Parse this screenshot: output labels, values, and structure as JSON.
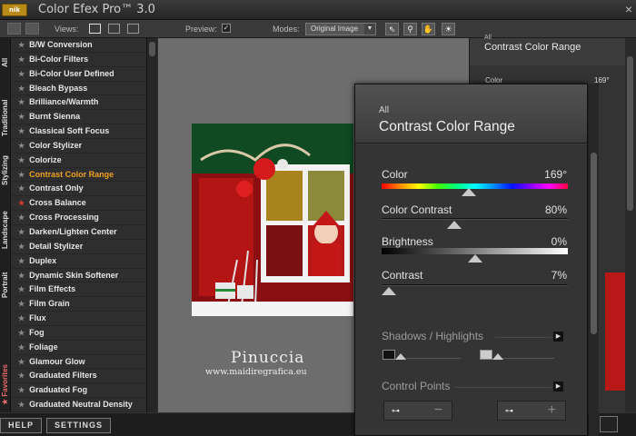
{
  "app": {
    "logo_text": "nik",
    "title": "Color Efex Pro™ 3.0",
    "close_label": "×"
  },
  "toolbar": {
    "views_label": "Views:",
    "preview_label": "Preview:",
    "preview_check": "✓",
    "modes_label": "Modes:",
    "mode_value": "Original Image",
    "mode_arrow": "▼",
    "tools": [
      "⇖",
      "⚲",
      "✋",
      "☀"
    ]
  },
  "categories": [
    {
      "label": "All",
      "fav": false
    },
    {
      "label": "Traditional",
      "fav": false
    },
    {
      "label": "Stylizing",
      "fav": false
    },
    {
      "label": "Landscape",
      "fav": false
    },
    {
      "label": "Portrait",
      "fav": false
    },
    {
      "label": "★ Favorites",
      "fav": true
    }
  ],
  "filters": [
    {
      "label": "B/W Conversion",
      "state": "normal"
    },
    {
      "label": "Bi-Color Filters",
      "state": "normal"
    },
    {
      "label": "Bi-Color User Defined",
      "state": "normal"
    },
    {
      "label": "Bleach Bypass",
      "state": "normal"
    },
    {
      "label": "Brilliance/Warmth",
      "state": "normal"
    },
    {
      "label": "Burnt Sienna",
      "state": "normal"
    },
    {
      "label": "Classical Soft Focus",
      "state": "normal"
    },
    {
      "label": "Color Stylizer",
      "state": "normal"
    },
    {
      "label": "Colorize",
      "state": "normal"
    },
    {
      "label": "Contrast Color Range",
      "state": "active"
    },
    {
      "label": "Contrast Only",
      "state": "normal"
    },
    {
      "label": "Cross Balance",
      "state": "favorite"
    },
    {
      "label": "Cross Processing",
      "state": "normal"
    },
    {
      "label": "Darken/Lighten Center",
      "state": "normal"
    },
    {
      "label": "Detail Stylizer",
      "state": "normal"
    },
    {
      "label": "Duplex",
      "state": "normal"
    },
    {
      "label": "Dynamic Skin Softener",
      "state": "normal"
    },
    {
      "label": "Film Effects",
      "state": "normal"
    },
    {
      "label": "Film Grain",
      "state": "normal"
    },
    {
      "label": "Flux",
      "state": "normal"
    },
    {
      "label": "Fog",
      "state": "normal"
    },
    {
      "label": "Foliage",
      "state": "normal"
    },
    {
      "label": "Glamour Glow",
      "state": "normal"
    },
    {
      "label": "Graduated Filters",
      "state": "normal"
    },
    {
      "label": "Graduated Fog",
      "state": "normal"
    },
    {
      "label": "Graduated Neutral Density",
      "state": "normal"
    }
  ],
  "watermark": {
    "name": "Pinuccia",
    "url": "www.maidiregrafica.eu"
  },
  "bottom": {
    "help": "HELP",
    "settings": "SETTINGS"
  },
  "background_panel": {
    "category": "All",
    "title": "Contrast Color Range",
    "color_label": "Color",
    "color_value": "169°"
  },
  "filter_panel": {
    "category": "All",
    "title": "Contrast Color Range",
    "sliders": [
      {
        "label": "Color",
        "value": "169°",
        "fraction": 0.47
      },
      {
        "label": "Color Contrast",
        "value": "80%",
        "fraction": 0.39
      },
      {
        "label": "Brightness",
        "value": "0%",
        "fraction": 0.5
      },
      {
        "label": "Contrast",
        "value": "7%",
        "fraction": 0.04
      }
    ],
    "shadows_highlights": "Shadows / Highlights",
    "control_points": "Control Points",
    "section_arrow": "▶",
    "cp_minus": "−",
    "cp_plus": "+",
    "cp_icon": "⊶"
  }
}
